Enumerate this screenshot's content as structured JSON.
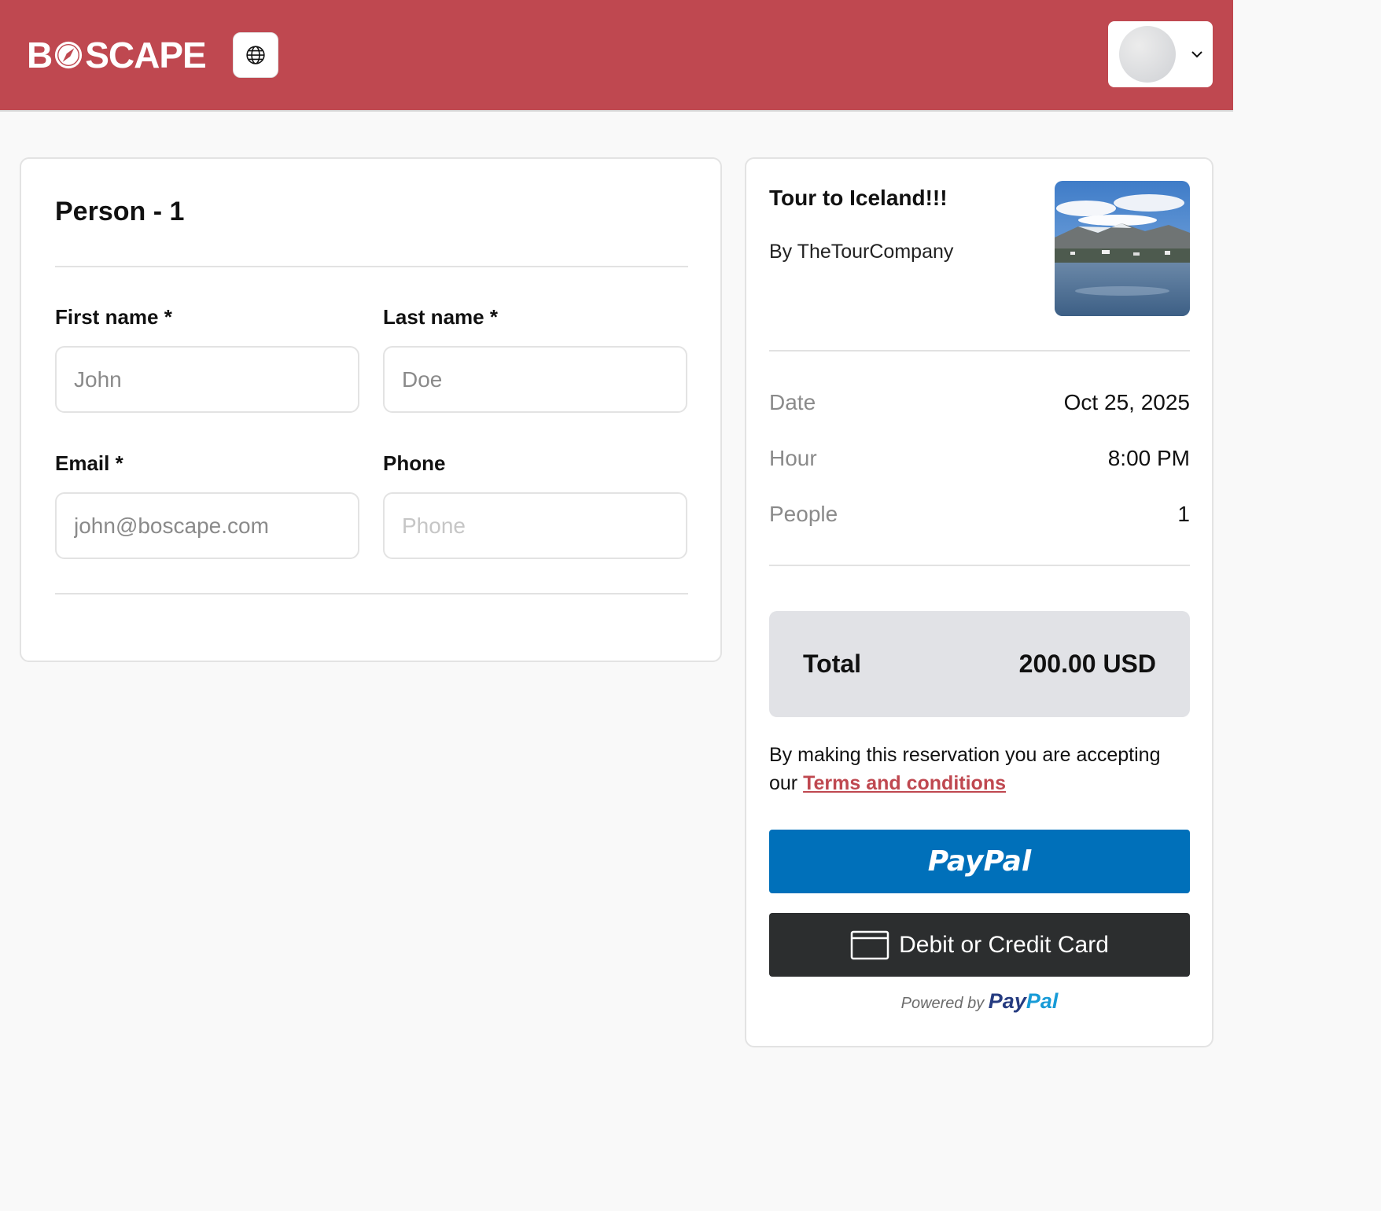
{
  "header": {
    "logo_text_start": "B",
    "logo_text_end": "SCAPE",
    "language_icon": "globe-icon",
    "user_menu_icon": "chevron-down-icon",
    "brand_color": "#bf4850"
  },
  "person_form": {
    "title": "Person - 1",
    "first_name": {
      "label": "First name *",
      "placeholder": "John"
    },
    "last_name": {
      "label": "Last name *",
      "placeholder": "Doe"
    },
    "email": {
      "label": "Email *",
      "placeholder": "john@boscape.com"
    },
    "phone": {
      "label": "Phone",
      "placeholder": "Phone"
    }
  },
  "summary": {
    "tour_title": "Tour to Iceland!!!",
    "company": "By TheTourCompany",
    "details": [
      {
        "key": "Date",
        "value": "Oct 25, 2025"
      },
      {
        "key": "Hour",
        "value": "8:00 PM"
      },
      {
        "key": "People",
        "value": "1"
      }
    ],
    "total_label": "Total",
    "total_value": "200.00 USD",
    "terms_text": "By making this reservation you are accepting our",
    "terms_link": "Terms and conditions",
    "paypal_button": "PayPal",
    "card_button": "Debit or Credit Card",
    "powered_by": "Powered by",
    "powered_pay": "Pay",
    "powered_pal": "Pal",
    "paypal_color": "#0070ba"
  }
}
